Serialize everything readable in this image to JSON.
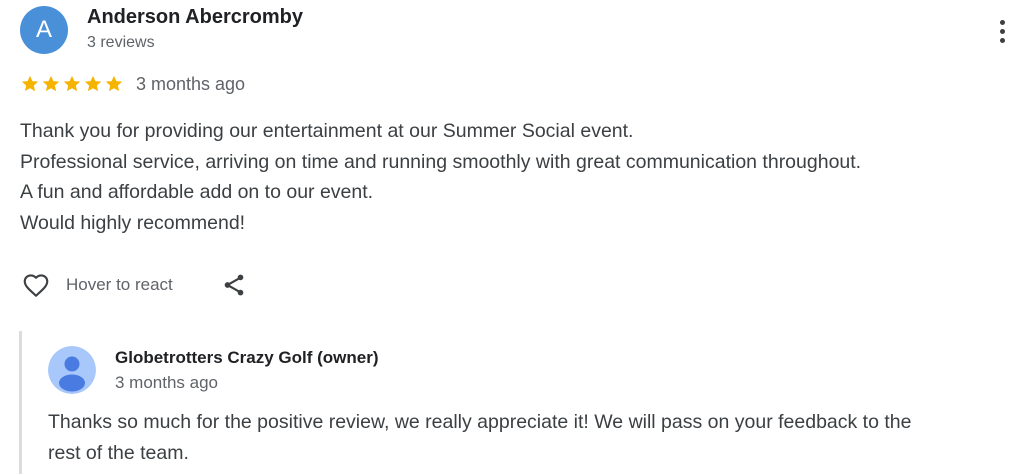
{
  "review": {
    "avatar_initial": "A",
    "avatar_color": "#4a90d9",
    "reviewer_name": "Anderson Abercromby",
    "review_count": "3 reviews",
    "rating": 5,
    "max_rating": 5,
    "star_color": "#f4b400",
    "date": "3 months ago",
    "body_lines": [
      "Thank you for providing our entertainment at our Summer Social event.",
      "Professional service, arriving on time and running smoothly with great communication throughout.",
      "A fun and affordable add on to our event.",
      "Would highly recommend!"
    ],
    "react_label": "Hover to react",
    "icons": {
      "menu": "more-vert-icon",
      "react": "heart-outline-icon",
      "share": "share-icon"
    }
  },
  "owner_reply": {
    "name": "Globetrotters Crazy Golf (owner)",
    "date": "3 months ago",
    "avatar_icon": "default-profile-icon",
    "avatar_bg": "#a8c7fa",
    "avatar_fg": "#4a7be0",
    "body_lines": [
      "Thanks so much for the positive review, we really appreciate it! We will pass on your feedback to the",
      "rest of the team."
    ]
  }
}
